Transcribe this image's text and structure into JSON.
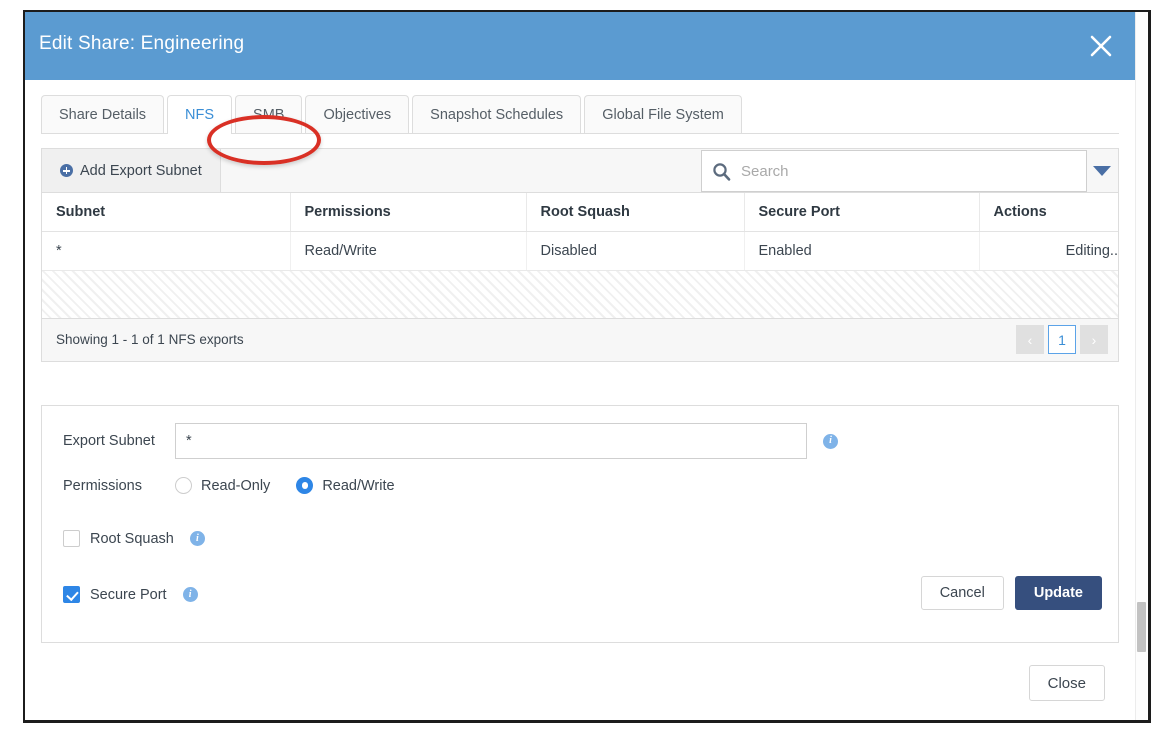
{
  "dialog": {
    "title": "Edit Share: Engineering",
    "close_icon": "close-x-icon",
    "footer_close_label": "Close"
  },
  "tabs": {
    "items": [
      {
        "label": "Share Details",
        "active": false
      },
      {
        "label": "NFS",
        "active": true
      },
      {
        "label": "SMB",
        "active": false
      },
      {
        "label": "Objectives",
        "active": false
      },
      {
        "label": "Snapshot Schedules",
        "active": false
      },
      {
        "label": "Global File System",
        "active": false
      }
    ],
    "annotation": {
      "type": "ellipse-highlight",
      "target": "NFS",
      "color": "#d93025"
    }
  },
  "toolbar": {
    "add_label": "Add Export Subnet",
    "add_icon": "plus-circle-icon",
    "search_placeholder": "Search",
    "search_value": "",
    "search_icon": "search-icon",
    "filter_caret_icon": "caret-down-icon"
  },
  "table": {
    "columns": [
      "Subnet",
      "Permissions",
      "Root Squash",
      "Secure Port",
      "Actions"
    ],
    "rows": [
      {
        "subnet": "*",
        "permissions": "Read/Write",
        "root_squash": "Disabled",
        "secure_port": "Enabled",
        "actions": "Editing.."
      }
    ],
    "footer_text": "Showing 1 - 1 of 1 NFS exports",
    "pagination": {
      "prev_label": "‹",
      "pages": [
        "1"
      ],
      "current_page": "1",
      "next_label": "›"
    }
  },
  "form": {
    "export_subnet": {
      "label": "Export Subnet",
      "value": "*",
      "placeholder": "",
      "info_icon": "info-icon"
    },
    "permissions": {
      "label": "Permissions",
      "options": [
        {
          "label": "Read-Only",
          "selected": false
        },
        {
          "label": "Read/Write",
          "selected": true
        }
      ]
    },
    "root_squash": {
      "label": "Root Squash",
      "checked": false,
      "info_icon": "info-icon"
    },
    "secure_port": {
      "label": "Secure Port",
      "checked": true,
      "info_icon": "info-icon"
    },
    "cancel_label": "Cancel",
    "update_label": "Update"
  },
  "colors": {
    "header_blue": "#5b9bd1",
    "accent_blue": "#3a8ed6",
    "primary_button": "#364f7e",
    "control_blue": "#2e86e6",
    "annotation_red": "#d93025",
    "info_blue": "#7fb3e8"
  }
}
